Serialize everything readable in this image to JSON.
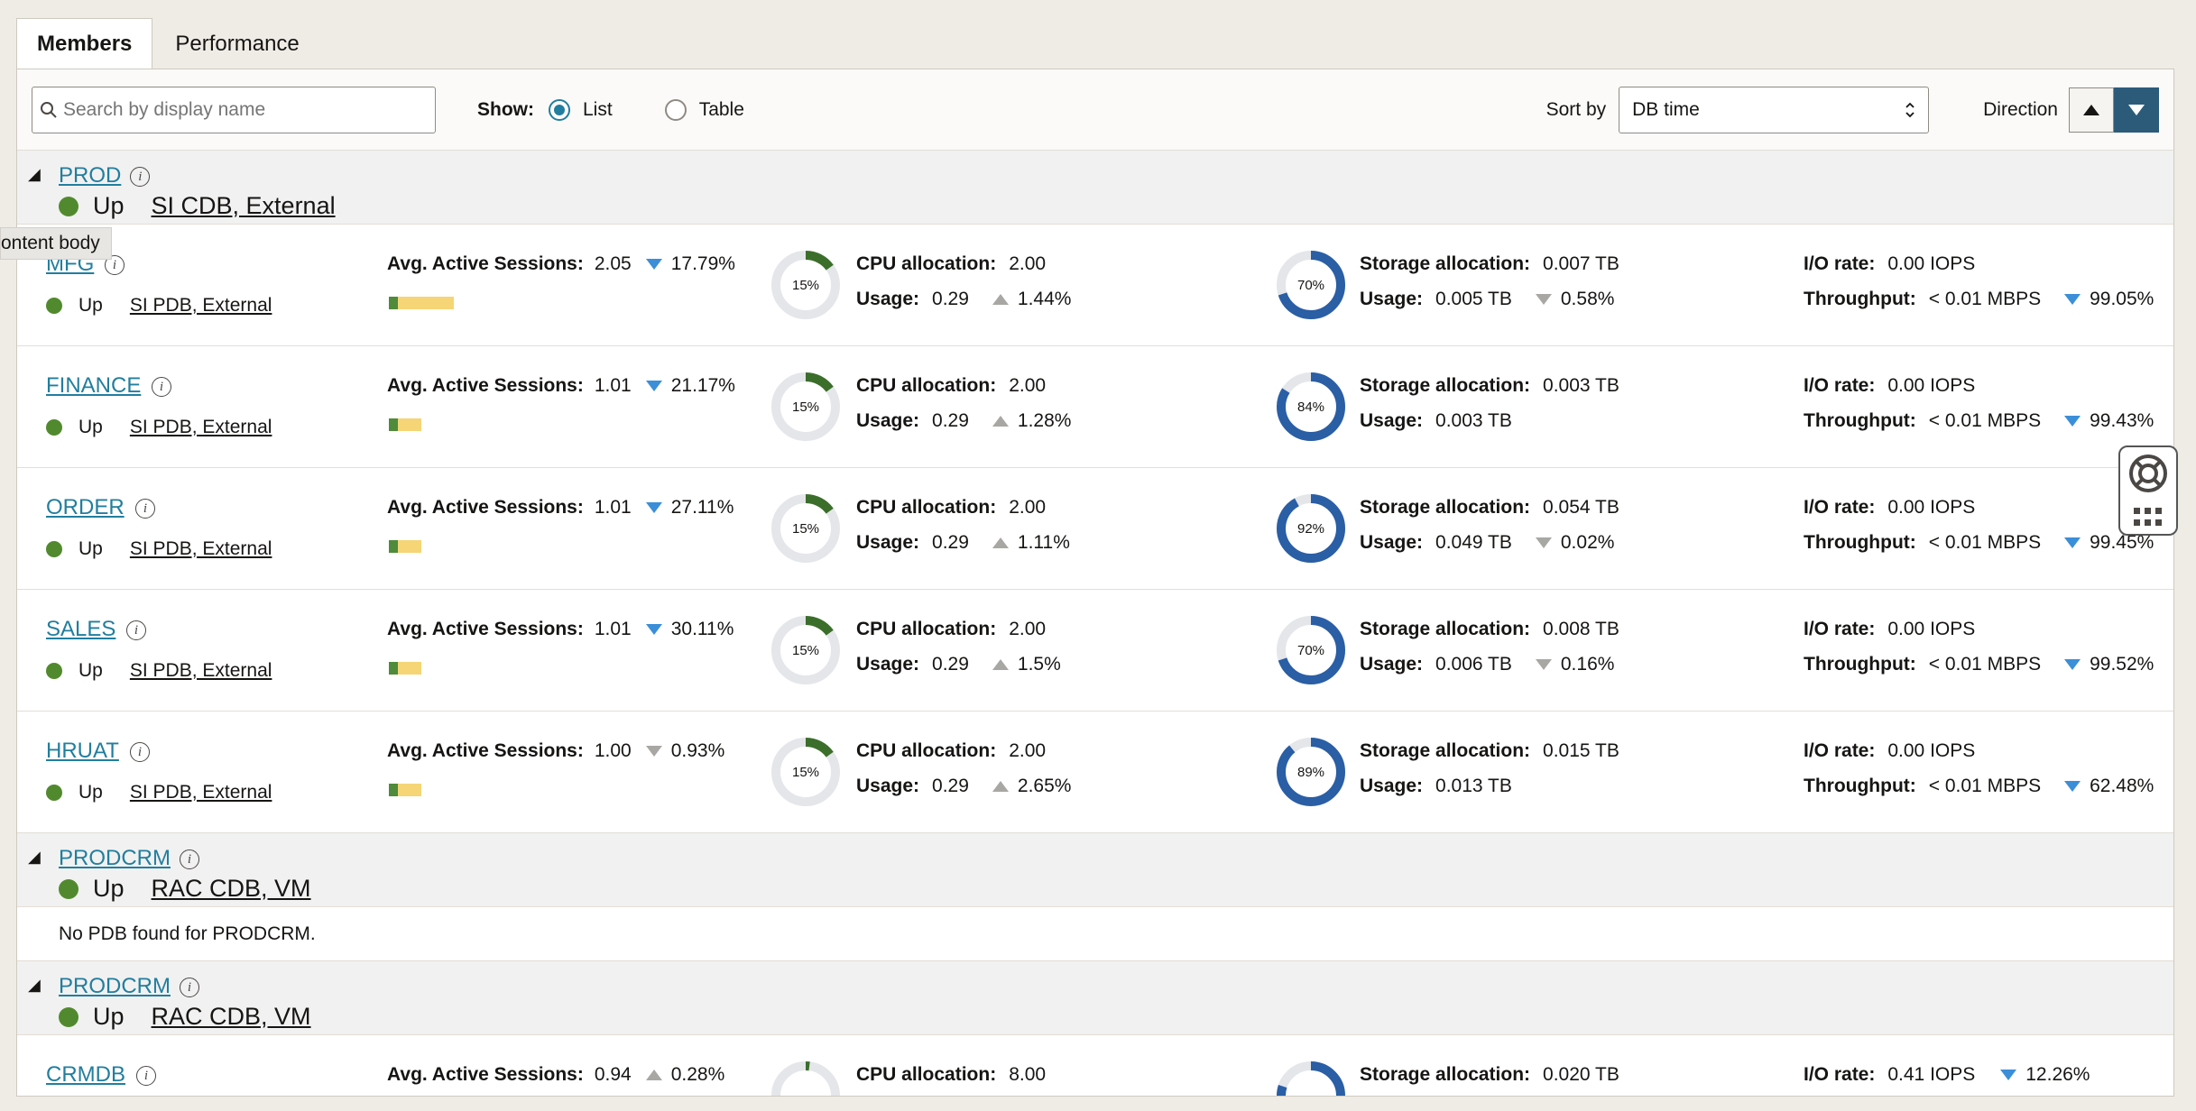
{
  "tabs": [
    {
      "label": "Members",
      "active": true
    },
    {
      "label": "Performance",
      "active": false
    }
  ],
  "toolbar": {
    "search_placeholder": "Search by display name",
    "show_label": "Show:",
    "show_options": [
      "List",
      "Table"
    ],
    "show_selected": "List",
    "sort_label": "Sort by",
    "sort_value": "DB time",
    "direction_label": "Direction",
    "direction_selected": "descending"
  },
  "tooltip": "ontent body",
  "labels": {
    "aas": "Avg. Active Sessions:",
    "cpu_alloc": "CPU allocation:",
    "usage": "Usage:",
    "storage_alloc": "Storage allocation:",
    "io_rate": "I/O rate:",
    "throughput": "Throughput:",
    "up": "Up"
  },
  "groups": [
    {
      "name": "PROD",
      "status": "Up",
      "type": "SI CDB, External",
      "pdbs": [
        {
          "name": "MFG",
          "status": "Up",
          "type": "SI PDB, External",
          "aas": "2.05",
          "aas_delta": "17.79%",
          "aas_dir": "down",
          "aas_bar": 0.36,
          "cpu_pct": 15,
          "cpu_label": "15%",
          "cpu_alloc": "2.00",
          "cpu_usage": "0.29",
          "cpu_delta": "1.44%",
          "cpu_dir": "up",
          "st_pct": 70,
          "st_label": "70%",
          "st_alloc": "0.007 TB",
          "st_usage": "0.005 TB",
          "st_delta": "0.58%",
          "st_dir": "down-gray",
          "io_rate": "0.00 IOPS",
          "io_delta": "",
          "throughput": "< 0.01 MBPS",
          "tp_delta": "99.05%"
        },
        {
          "name": "FINANCE",
          "status": "Up",
          "type": "SI PDB, External",
          "aas": "1.01",
          "aas_delta": "21.17%",
          "aas_dir": "down",
          "aas_bar": 0.18,
          "cpu_pct": 15,
          "cpu_label": "15%",
          "cpu_alloc": "2.00",
          "cpu_usage": "0.29",
          "cpu_delta": "1.28%",
          "cpu_dir": "up",
          "st_pct": 84,
          "st_label": "84%",
          "st_alloc": "0.003 TB",
          "st_usage": "0.003 TB",
          "st_delta": "",
          "st_dir": "",
          "io_rate": "0.00 IOPS",
          "io_delta": "",
          "throughput": "< 0.01 MBPS",
          "tp_delta": "99.43%"
        },
        {
          "name": "ORDER",
          "status": "Up",
          "type": "SI PDB, External",
          "aas": "1.01",
          "aas_delta": "27.11%",
          "aas_dir": "down",
          "aas_bar": 0.18,
          "cpu_pct": 15,
          "cpu_label": "15%",
          "cpu_alloc": "2.00",
          "cpu_usage": "0.29",
          "cpu_delta": "1.11%",
          "cpu_dir": "up",
          "st_pct": 92,
          "st_label": "92%",
          "st_alloc": "0.054 TB",
          "st_usage": "0.049 TB",
          "st_delta": "0.02%",
          "st_dir": "down-gray",
          "io_rate": "0.00 IOPS",
          "io_delta": "",
          "throughput": "< 0.01 MBPS",
          "tp_delta": "99.45%"
        },
        {
          "name": "SALES",
          "status": "Up",
          "type": "SI PDB, External",
          "aas": "1.01",
          "aas_delta": "30.11%",
          "aas_dir": "down",
          "aas_bar": 0.18,
          "cpu_pct": 15,
          "cpu_label": "15%",
          "cpu_alloc": "2.00",
          "cpu_usage": "0.29",
          "cpu_delta": "1.5%",
          "cpu_dir": "up",
          "st_pct": 70,
          "st_label": "70%",
          "st_alloc": "0.008 TB",
          "st_usage": "0.006 TB",
          "st_delta": "0.16%",
          "st_dir": "down-gray",
          "io_rate": "0.00 IOPS",
          "io_delta": "",
          "throughput": "< 0.01 MBPS",
          "tp_delta": "99.52%"
        },
        {
          "name": "HRUAT",
          "status": "Up",
          "type": "SI PDB, External",
          "aas": "1.00",
          "aas_delta": "0.93%",
          "aas_dir": "down-gray",
          "aas_bar": 0.18,
          "cpu_pct": 15,
          "cpu_label": "15%",
          "cpu_alloc": "2.00",
          "cpu_usage": "0.29",
          "cpu_delta": "2.65%",
          "cpu_dir": "up",
          "st_pct": 89,
          "st_label": "89%",
          "st_alloc": "0.015 TB",
          "st_usage": "0.013 TB",
          "st_delta": "",
          "st_dir": "",
          "io_rate": "0.00 IOPS",
          "io_delta": "",
          "throughput": "< 0.01 MBPS",
          "tp_delta": "62.48%"
        }
      ]
    },
    {
      "name": "PRODCRM",
      "status": "Up",
      "type": "RAC CDB, VM",
      "empty_text": "No PDB found for PRODCRM.",
      "pdbs": []
    },
    {
      "name": "PRODCRM",
      "status": "Up",
      "type": "RAC CDB, VM",
      "pdbs": [
        {
          "name": "CRMDB",
          "status": "Up",
          "type": "",
          "aas": "0.94",
          "aas_delta": "0.28%",
          "aas_dir": "up",
          "aas_bar": 0.18,
          "cpu_pct": 2,
          "cpu_label": "",
          "cpu_alloc": "8.00",
          "cpu_usage": "",
          "cpu_delta": "",
          "cpu_dir": "",
          "st_pct": 80,
          "st_label": "",
          "st_alloc": "0.020 TB",
          "st_usage": "",
          "st_delta": "",
          "st_dir": "",
          "io_rate": "0.41 IOPS",
          "io_delta": "12.26%",
          "throughput": "",
          "tp_delta": ""
        }
      ]
    }
  ],
  "colors": {
    "link": "#227e9e",
    "up_green": "#518a2e",
    "cpu_ring": "#3b6e2a",
    "storage_ring": "#2a5ea5",
    "ring_bg": "#e4e6ea",
    "delta_down": "#3b8ed8"
  }
}
